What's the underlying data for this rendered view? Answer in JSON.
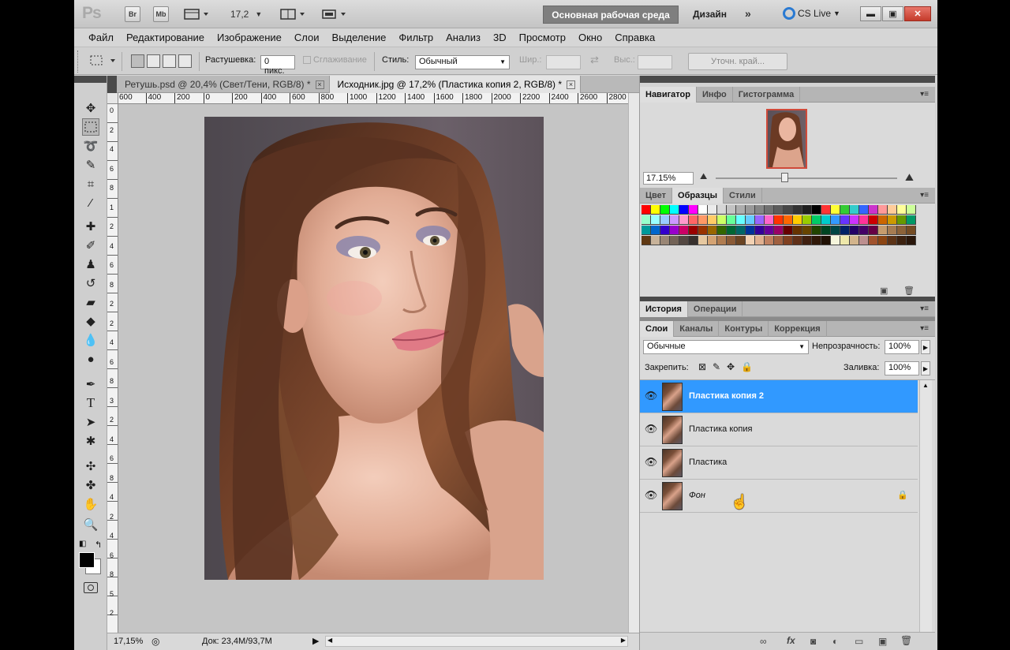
{
  "app": {
    "logo": "Ps",
    "bar_buttons": [
      "Br",
      "Mb"
    ],
    "zoom_select": "17,2",
    "workspace_active": "Основная рабочая среда",
    "workspace_design": "Дизайн",
    "workspace_more": "»",
    "cs_live": "CS Live"
  },
  "menu": [
    "Файл",
    "Редактирование",
    "Изображение",
    "Слои",
    "Выделение",
    "Фильтр",
    "Анализ",
    "3D",
    "Просмотр",
    "Окно",
    "Справка"
  ],
  "options": {
    "feather_label": "Растушевка:",
    "feather_value": "0 пикс.",
    "antialias_label": "Сглаживание",
    "style_label": "Стиль:",
    "style_value": "Обычный",
    "width_label": "Шир.:",
    "height_label": "Выс.:",
    "refine_edge": "Уточн. край..."
  },
  "tabs": [
    {
      "label": "Ретушь.psd @ 20,4% (Свет/Тени, RGB/8) *",
      "close": "×"
    },
    {
      "label": "Исходник.jpg @ 17,2% (Пластика копия 2, RGB/8) *",
      "close": "×"
    }
  ],
  "ruler_top": [
    "600",
    "400",
    "200",
    "0",
    "200",
    "400",
    "600",
    "800",
    "1000",
    "1200",
    "1400",
    "1600",
    "1800",
    "2000",
    "2200",
    "2400",
    "2600",
    "2800"
  ],
  "ruler_left": [
    "0",
    "2",
    "4",
    "6",
    "8",
    "1",
    "2",
    "4",
    "6",
    "8",
    "2",
    "2",
    "4",
    "6",
    "8",
    "3",
    "2",
    "4",
    "6",
    "8",
    "4",
    "2",
    "4",
    "6",
    "8",
    "5",
    "2"
  ],
  "status": {
    "zoom": "17,15%",
    "doc": "Док: 23,4М/93,7М"
  },
  "navigator": {
    "tabs": [
      "Навигатор",
      "Инфо",
      "Гистограмма"
    ],
    "zoom": "17.15%"
  },
  "swatches_panel": {
    "tabs": [
      "Цвет",
      "Образцы",
      "Стили"
    ]
  },
  "history_panel": {
    "tabs": [
      "История",
      "Операции"
    ]
  },
  "layers_panel": {
    "tabs": [
      "Слои",
      "Каналы",
      "Контуры",
      "Коррекция"
    ],
    "blend_mode": "Обычные",
    "opacity_label": "Непрозрачность:",
    "opacity_value": "100%",
    "lock_label": "Закрепить:",
    "fill_label": "Заливка:",
    "fill_value": "100%",
    "layers": [
      {
        "name": "Пластика копия 2",
        "selected": true,
        "locked": false
      },
      {
        "name": "Пластика копия",
        "selected": false,
        "locked": false
      },
      {
        "name": "Пластика",
        "selected": false,
        "locked": false
      },
      {
        "name": "Фон",
        "selected": false,
        "locked": true
      }
    ]
  },
  "swatch_colors": [
    "#ff0000",
    "#ffff00",
    "#00ff00",
    "#00ffff",
    "#0000ff",
    "#ff00ff",
    "#ffffff",
    "#ebebeb",
    "#d6d6d6",
    "#c2c2c2",
    "#adadad",
    "#999999",
    "#858585",
    "#707070",
    "#5c5c5c",
    "#474747",
    "#333333",
    "#1f1f1f",
    "#000000",
    "#ff3333",
    "#ffff33",
    "#33cc33",
    "#33cccc",
    "#3366ff",
    "#cc33cc",
    "#ff9999",
    "#ffcc99",
    "#ffff99",
    "#ccff99",
    "#99ffcc",
    "#99ffff",
    "#99ccff",
    "#cc99ff",
    "#ff99cc",
    "#ff6666",
    "#ff9966",
    "#ffcc66",
    "#ccff66",
    "#66ff99",
    "#66ffff",
    "#66ccff",
    "#9966ff",
    "#ff66cc",
    "#ff3300",
    "#ff6600",
    "#ffcc00",
    "#99cc00",
    "#00cc66",
    "#00cccc",
    "#3399ff",
    "#6633ff",
    "#cc33ff",
    "#ff3399",
    "#cc0000",
    "#cc6600",
    "#cc9900",
    "#669900",
    "#009966",
    "#009999",
    "#0066cc",
    "#3300cc",
    "#9900cc",
    "#cc0066",
    "#990000",
    "#993300",
    "#996600",
    "#336600",
    "#006633",
    "#006666",
    "#003399",
    "#330099",
    "#660099",
    "#990066",
    "#660000",
    "#663300",
    "#664400",
    "#224400",
    "#004422",
    "#004444",
    "#002266",
    "#220066",
    "#440066",
    "#660044",
    "#c69c6d",
    "#a67c52",
    "#8c6239",
    "#754c24",
    "#603913",
    "#c7b299",
    "#998675",
    "#736357",
    "#534741",
    "#37302d",
    "#e6c8a0",
    "#d4a373",
    "#b07c50",
    "#8a5a36",
    "#6b4423",
    "#f2d1b3",
    "#e0b090",
    "#c08060",
    "#a06040",
    "#804020",
    "#603018",
    "#402010",
    "#301808",
    "#201004",
    "#f5f5dc",
    "#eee8aa",
    "#d2b48c",
    "#bc8f8f",
    "#a0522d",
    "#8b4513",
    "#5c3317",
    "#3d2210",
    "#2a170b"
  ]
}
